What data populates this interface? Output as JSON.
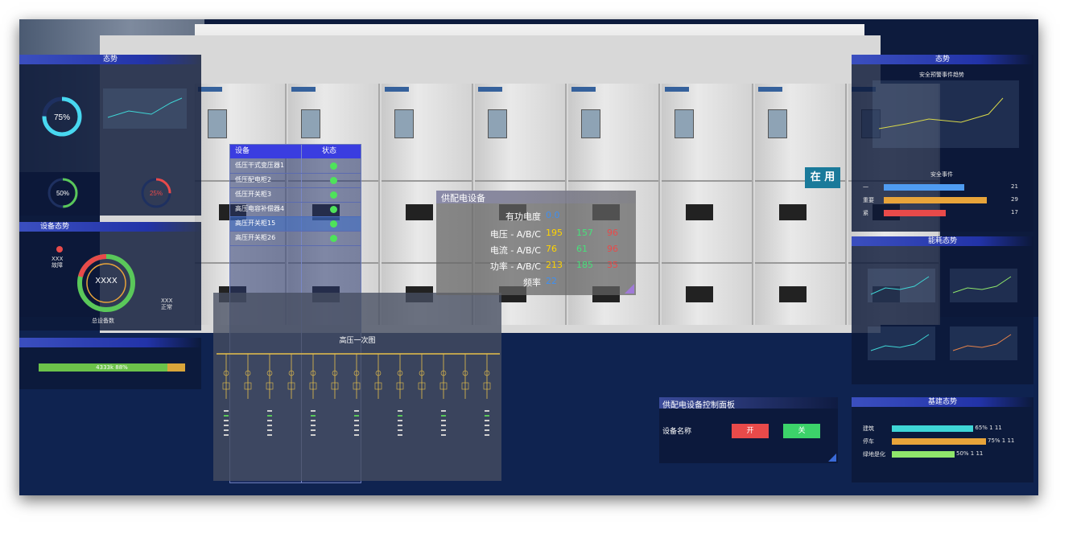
{
  "left": {
    "trend_title": "态势",
    "gauge1_value": "75%",
    "gauge2_value": "50%",
    "gauge3_value": "25%",
    "device_title": "设备态势",
    "fault_label": "XXX\n故障",
    "normal_label": "XXX\n正常",
    "ring_center": "XXXX",
    "total_label": "总设备数",
    "progress_text": "4333k 88%",
    "progress_fraction": 0.88
  },
  "table": {
    "col_device": "设备",
    "col_status": "状态",
    "rows": [
      {
        "name": "低压干式变压器1"
      },
      {
        "name": "低压配电柜2"
      },
      {
        "name": "低压开关柜3"
      },
      {
        "name": "高压电容补偿器4"
      },
      {
        "name": "高压开关柜15"
      },
      {
        "name": "高压开关柜26"
      }
    ]
  },
  "diagram": {
    "title": "高压一次图"
  },
  "info": {
    "title": "供配电设备",
    "active_power_label": "有功电度",
    "active_power_value": "0.0",
    "voltage_label": "电压 - A/B/C",
    "voltage": [
      "195",
      "157",
      "96"
    ],
    "current_label": "电流 - A/B/C",
    "current": [
      "76",
      "61",
      "96"
    ],
    "power_label": "功率 - A/B/C",
    "power": [
      "213",
      "185",
      "35"
    ],
    "freq_label": "频率",
    "freq_value": "22"
  },
  "cabinet": {
    "in_use": "在 用"
  },
  "right": {
    "trend_title": "态势",
    "safety_chart_title": "安全预警事件趋势",
    "safety_events_title": "安全事件",
    "events": [
      {
        "label": "一",
        "value": "21",
        "fraction": 0.78,
        "color": "#4f9cf2"
      },
      {
        "label": "重要",
        "value": "29",
        "fraction": 1.0,
        "color": "#e8a43a"
      },
      {
        "label": "紧",
        "value": "17",
        "fraction": 0.6,
        "color": "#e84a4a"
      }
    ],
    "energy_title": "能耗态势",
    "build_title": "基建态势",
    "build_items": [
      {
        "label": "建筑",
        "value": "65% 1 11",
        "fraction": 0.65,
        "color": "#3fd6d6"
      },
      {
        "label": "停车",
        "value": "75% 1 11",
        "fraction": 0.75,
        "color": "#e8a43a"
      },
      {
        "label": "绿地是化",
        "value": "50% 1 11",
        "fraction": 0.5,
        "color": "#8fe66b"
      }
    ]
  },
  "control": {
    "title": "供配电设备控制面板",
    "device_name_label": "设备名称",
    "on_label": "开",
    "off_label": "关"
  },
  "colors": {
    "on_button": "#e84a4a",
    "off_button": "#3cd36a",
    "value_yellow": "#ffd400",
    "value_green": "#47e07a",
    "value_red": "#e84a4a",
    "value_blue": "#3f8ff0"
  }
}
